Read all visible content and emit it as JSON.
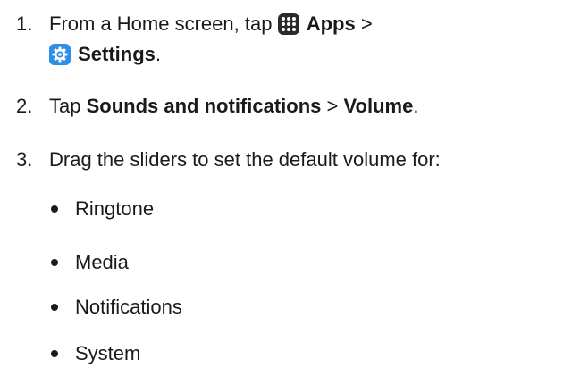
{
  "steps": [
    {
      "number": "1.",
      "text_1": "From a Home screen, tap",
      "apps_label": "Apps",
      "separator": ">",
      "settings_label": "Settings",
      "period": "."
    },
    {
      "number": "2.",
      "text_1": "Tap",
      "bold_1": "Sounds and notifications",
      "separator": ">",
      "bold_2": "Volume",
      "period": "."
    },
    {
      "number": "3.",
      "text_1": "Drag the sliders to set the default volume for:"
    }
  ],
  "bullets": [
    "Ringtone",
    "Media",
    "Notifications",
    "System"
  ],
  "icons": {
    "apps": "apps-grid-icon",
    "settings": "gear-icon"
  },
  "colors": {
    "text": "#1a1a1a",
    "apps_icon_bg": "#2b2b2b",
    "settings_icon_bg": "#2f8fe6"
  }
}
